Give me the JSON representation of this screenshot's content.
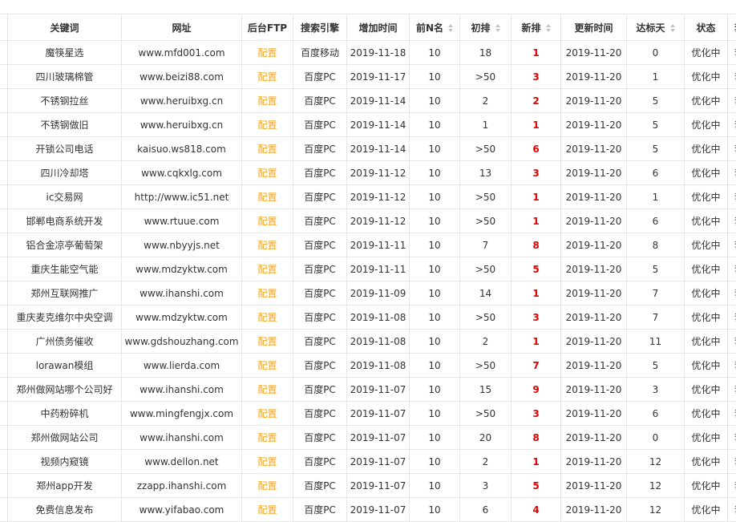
{
  "headers": {
    "keyword": "关键词",
    "url": "网址",
    "ftp": "后台FTP",
    "engine": "搜索引擎",
    "added": "增加时间",
    "topn": "前N名",
    "initial": "初排",
    "new": "新排",
    "updated": "更新时间",
    "days": "达标天",
    "status": "状态",
    "extra": "套"
  },
  "rows": [
    {
      "keyword": "魔筷星选",
      "url": "www.mfd001.com",
      "ftp": "配置",
      "engine": "百度移动",
      "added": "2019-11-18",
      "topn": "10",
      "initial": "18",
      "new": "1",
      "updated": "2019-11-20",
      "days": "0",
      "status": "优化中",
      "extra": "套"
    },
    {
      "keyword": "四川玻璃棉管",
      "url": "www.beizi88.com",
      "ftp": "配置",
      "engine": "百度PC",
      "added": "2019-11-17",
      "topn": "10",
      "initial": ">50",
      "new": "3",
      "updated": "2019-11-20",
      "days": "1",
      "status": "优化中",
      "extra": "套"
    },
    {
      "keyword": "不锈钢拉丝",
      "url": "www.heruibxg.cn",
      "ftp": "配置",
      "engine": "百度PC",
      "added": "2019-11-14",
      "topn": "10",
      "initial": "2",
      "new": "2",
      "updated": "2019-11-20",
      "days": "5",
      "status": "优化中",
      "extra": "套"
    },
    {
      "keyword": "不锈钢做旧",
      "url": "www.heruibxg.cn",
      "ftp": "配置",
      "engine": "百度PC",
      "added": "2019-11-14",
      "topn": "10",
      "initial": "1",
      "new": "1",
      "updated": "2019-11-20",
      "days": "5",
      "status": "优化中",
      "extra": "套"
    },
    {
      "keyword": "开锁公司电话",
      "url": "kaisuo.ws818.com",
      "ftp": "配置",
      "engine": "百度PC",
      "added": "2019-11-14",
      "topn": "10",
      "initial": ">50",
      "new": "6",
      "updated": "2019-11-20",
      "days": "5",
      "status": "优化中",
      "extra": "套"
    },
    {
      "keyword": "四川冷却塔",
      "url": "www.cqkxlg.com",
      "ftp": "配置",
      "engine": "百度PC",
      "added": "2019-11-12",
      "topn": "10",
      "initial": "13",
      "new": "3",
      "updated": "2019-11-20",
      "days": "6",
      "status": "优化中",
      "extra": "套"
    },
    {
      "keyword": "ic交易网",
      "url": "http://www.ic51.net",
      "ftp": "配置",
      "engine": "百度PC",
      "added": "2019-11-12",
      "topn": "10",
      "initial": ">50",
      "new": "1",
      "updated": "2019-11-20",
      "days": "1",
      "status": "优化中",
      "extra": "套"
    },
    {
      "keyword": "邯郸电商系统开发",
      "url": "www.rtuue.com",
      "ftp": "配置",
      "engine": "百度PC",
      "added": "2019-11-12",
      "topn": "10",
      "initial": ">50",
      "new": "1",
      "updated": "2019-11-20",
      "days": "6",
      "status": "优化中",
      "extra": "套"
    },
    {
      "keyword": "铝合金凉亭葡萄架",
      "url": "www.nbyyjs.net",
      "ftp": "配置",
      "engine": "百度PC",
      "added": "2019-11-11",
      "topn": "10",
      "initial": "7",
      "new": "8",
      "updated": "2019-11-20",
      "days": "8",
      "status": "优化中",
      "extra": "套"
    },
    {
      "keyword": "重庆生能空气能",
      "url": "www.mdzyktw.com",
      "ftp": "配置",
      "engine": "百度PC",
      "added": "2019-11-11",
      "topn": "10",
      "initial": ">50",
      "new": "5",
      "updated": "2019-11-20",
      "days": "5",
      "status": "优化中",
      "extra": "套"
    },
    {
      "keyword": "郑州互联网推广",
      "url": "www.ihanshi.com",
      "ftp": "配置",
      "engine": "百度PC",
      "added": "2019-11-09",
      "topn": "10",
      "initial": "14",
      "new": "1",
      "updated": "2019-11-20",
      "days": "7",
      "status": "优化中",
      "extra": "套"
    },
    {
      "keyword": "重庆麦克维尔中央空调",
      "url": "www.mdzyktw.com",
      "ftp": "配置",
      "engine": "百度PC",
      "added": "2019-11-08",
      "topn": "10",
      "initial": ">50",
      "new": "3",
      "updated": "2019-11-20",
      "days": "7",
      "status": "优化中",
      "extra": "套"
    },
    {
      "keyword": "广州债务催收",
      "url": "www.gdshouzhang.com",
      "ftp": "配置",
      "engine": "百度PC",
      "added": "2019-11-08",
      "topn": "10",
      "initial": "2",
      "new": "1",
      "updated": "2019-11-20",
      "days": "11",
      "status": "优化中",
      "extra": "套"
    },
    {
      "keyword": "lorawan模组",
      "url": "www.lierda.com",
      "ftp": "配置",
      "engine": "百度PC",
      "added": "2019-11-08",
      "topn": "10",
      "initial": ">50",
      "new": "7",
      "updated": "2019-11-20",
      "days": "5",
      "status": "优化中",
      "extra": "套"
    },
    {
      "keyword": "郑州做网站哪个公司好",
      "url": "www.ihanshi.com",
      "ftp": "配置",
      "engine": "百度PC",
      "added": "2019-11-07",
      "topn": "10",
      "initial": "15",
      "new": "9",
      "updated": "2019-11-20",
      "days": "3",
      "status": "优化中",
      "extra": "套"
    },
    {
      "keyword": "中药粉碎机",
      "url": "www.mingfengjx.com",
      "ftp": "配置",
      "engine": "百度PC",
      "added": "2019-11-07",
      "topn": "10",
      "initial": ">50",
      "new": "3",
      "updated": "2019-11-20",
      "days": "6",
      "status": "优化中",
      "extra": "套"
    },
    {
      "keyword": "郑州做网站公司",
      "url": "www.ihanshi.com",
      "ftp": "配置",
      "engine": "百度PC",
      "added": "2019-11-07",
      "topn": "10",
      "initial": "20",
      "new": "8",
      "updated": "2019-11-20",
      "days": "0",
      "status": "优化中",
      "extra": "套"
    },
    {
      "keyword": "视频内窥镜",
      "url": "www.dellon.net",
      "ftp": "配置",
      "engine": "百度PC",
      "added": "2019-11-07",
      "topn": "10",
      "initial": "2",
      "new": "1",
      "updated": "2019-11-20",
      "days": "12",
      "status": "优化中",
      "extra": "套"
    },
    {
      "keyword": "郑州app开发",
      "url": "zzapp.ihanshi.com",
      "ftp": "配置",
      "engine": "百度PC",
      "added": "2019-11-07",
      "topn": "10",
      "initial": "3",
      "new": "5",
      "updated": "2019-11-20",
      "days": "12",
      "status": "优化中",
      "extra": "套"
    },
    {
      "keyword": "免费信息发布",
      "url": "www.yifabao.com",
      "ftp": "配置",
      "engine": "百度PC",
      "added": "2019-11-07",
      "topn": "10",
      "initial": "6",
      "new": "4",
      "updated": "2019-11-20",
      "days": "12",
      "status": "优化中",
      "extra": "套"
    }
  ],
  "colors": {
    "config": "#f0a31e",
    "new_rank": "#e00000",
    "border": "#e6e6e6"
  }
}
